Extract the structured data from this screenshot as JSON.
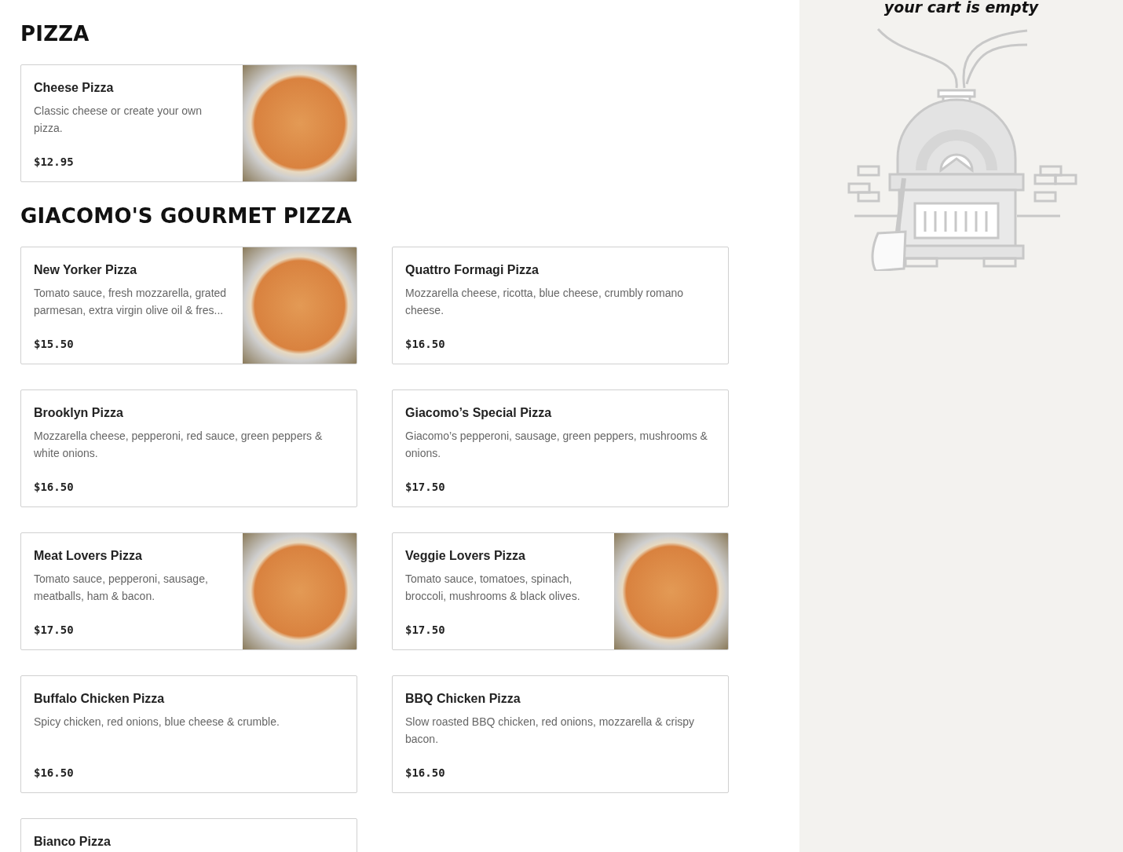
{
  "sections": [
    {
      "title": "PIZZA",
      "items": [
        {
          "name": "Cheese Pizza",
          "description": "Classic cheese or create your own pizza.",
          "price": "$12.95",
          "photo": true
        }
      ]
    },
    {
      "title": "GIACOMO'S GOURMET PIZZA",
      "items": [
        {
          "name": "New Yorker Pizza",
          "description": "Tomato sauce, fresh mozzarella, grated parmesan, extra virgin olive oil & fres...",
          "price": "$15.50",
          "photo": true
        },
        {
          "name": "Quattro Formagi Pizza",
          "description": "Mozzarella cheese, ricotta, blue cheese, crumbly romano cheese.",
          "price": "$16.50",
          "photo": false
        },
        {
          "name": "Brooklyn Pizza",
          "description": "Mozzarella cheese, pepperoni, red sauce, green peppers & white onions.",
          "price": "$16.50",
          "photo": false
        },
        {
          "name": "Giacomo’s Special Pizza",
          "description": "Giacomo’s pepperoni, sausage, green peppers, mushrooms & onions.",
          "price": "$17.50",
          "photo": false
        },
        {
          "name": "Meat Lovers Pizza",
          "description": "Tomato sauce, pepperoni, sausage, meatballs, ham & bacon.",
          "price": "$17.50",
          "photo": true
        },
        {
          "name": "Veggie Lovers Pizza",
          "description": "Tomato sauce, tomatoes, spinach, broccoli, mushrooms & black olives.",
          "price": "$17.50",
          "photo": true
        },
        {
          "name": "Buffalo Chicken Pizza",
          "description": "Spicy chicken, red onions, blue cheese & crumble.",
          "price": "$16.50",
          "photo": false
        },
        {
          "name": "BBQ Chicken Pizza",
          "description": "Slow roasted BBQ chicken, red onions, mozzarella & crispy bacon.",
          "price": "$16.50",
          "photo": false
        },
        {
          "name": "Bianco Pizza",
          "photo": false
        }
      ]
    }
  ],
  "cart": {
    "message": "your cart is empty"
  }
}
